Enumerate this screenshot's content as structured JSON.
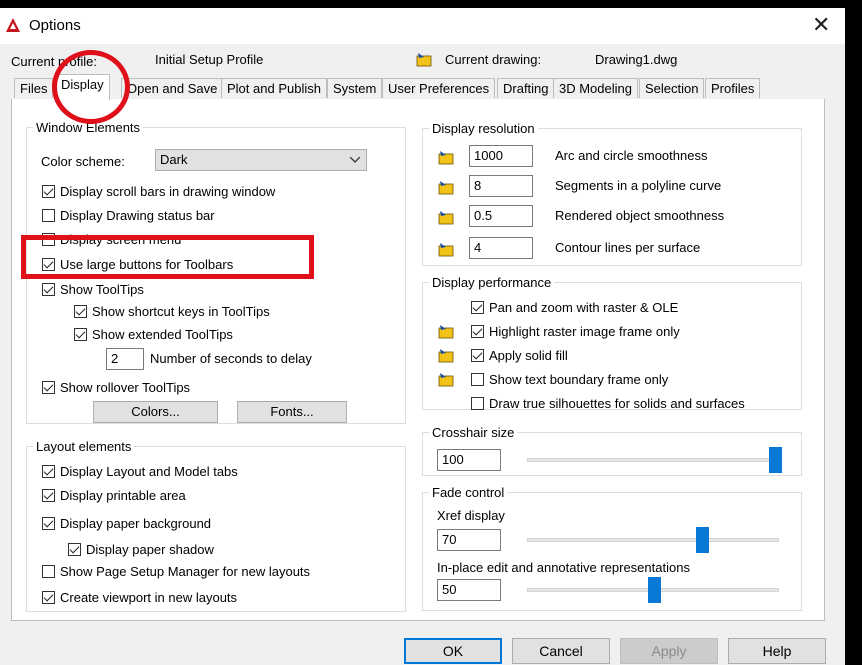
{
  "window": {
    "title": "Options",
    "close_glyph": "✕"
  },
  "header": {
    "current_profile_label": "Current profile:",
    "current_profile_value": "Initial Setup Profile",
    "current_drawing_label": "Current drawing:",
    "current_drawing_value": "Drawing1.dwg"
  },
  "tabs": [
    {
      "label": "Files"
    },
    {
      "label": "Display"
    },
    {
      "label": "Open and Save"
    },
    {
      "label": "Plot and Publish"
    },
    {
      "label": "System"
    },
    {
      "label": "User Preferences"
    },
    {
      "label": "Drafting"
    },
    {
      "label": "3D Modeling"
    },
    {
      "label": "Selection"
    },
    {
      "label": "Profiles"
    }
  ],
  "active_tab": "Display",
  "window_elements": {
    "legend": "Window Elements",
    "color_scheme_label": "Color scheme:",
    "color_scheme_value": "Dark",
    "checkboxes": [
      {
        "label": "Display scroll bars in drawing window",
        "checked": true
      },
      {
        "label": "Display Drawing status bar",
        "checked": false
      },
      {
        "label": "Display screen menu",
        "checked": false
      },
      {
        "label": "Use large buttons for Toolbars",
        "checked": true
      },
      {
        "label": "Show ToolTips",
        "checked": true
      },
      {
        "label": "Show shortcut keys in ToolTips",
        "checked": true
      },
      {
        "label": "Show extended ToolTips",
        "checked": true
      }
    ],
    "delay_value": "2",
    "delay_label": "Number of seconds to delay",
    "rollover_label": "Show rollover ToolTips",
    "rollover_checked": true,
    "colors_button": "Colors...",
    "fonts_button": "Fonts..."
  },
  "layout_elements": {
    "legend": "Layout elements",
    "checkboxes": [
      {
        "label": "Display Layout and Model tabs",
        "checked": true
      },
      {
        "label": "Display printable area",
        "checked": true
      },
      {
        "label": "Display paper background",
        "checked": true
      },
      {
        "label": "Display paper shadow",
        "checked": true
      },
      {
        "label": "Show Page Setup Manager for new layouts",
        "checked": false
      },
      {
        "label": "Create viewport in new layouts",
        "checked": true
      }
    ]
  },
  "display_resolution": {
    "legend": "Display resolution",
    "rows": [
      {
        "value": "1000",
        "label": "Arc and circle smoothness"
      },
      {
        "value": "8",
        "label": "Segments in a polyline curve"
      },
      {
        "value": "0.5",
        "label": "Rendered object smoothness"
      },
      {
        "value": "4",
        "label": "Contour lines per surface"
      }
    ]
  },
  "display_performance": {
    "legend": "Display performance",
    "checkboxes": [
      {
        "label": "Pan and zoom with raster & OLE",
        "checked": true
      },
      {
        "label": "Highlight raster image frame only",
        "checked": true
      },
      {
        "label": "Apply solid fill",
        "checked": true
      },
      {
        "label": "Show text boundary frame only",
        "checked": false
      },
      {
        "label": "Draw true silhouettes for solids and surfaces",
        "checked": false
      }
    ]
  },
  "crosshair": {
    "legend": "Crosshair size",
    "value": "100",
    "level_percent": 100
  },
  "fade_control": {
    "legend": "Fade control",
    "xref_label": "Xref display",
    "xref_value": "70",
    "xref_level_percent": 70,
    "inplace_label": "In-place edit and annotative representations",
    "inplace_value": "50",
    "inplace_level_percent": 50
  },
  "buttons": {
    "ok": "OK",
    "cancel": "Cancel",
    "apply": "Apply",
    "help": "Help"
  },
  "colors": {
    "accent": "#0a78d7",
    "annotation": "#e0101a",
    "drawing_icon": "#f2c318"
  }
}
